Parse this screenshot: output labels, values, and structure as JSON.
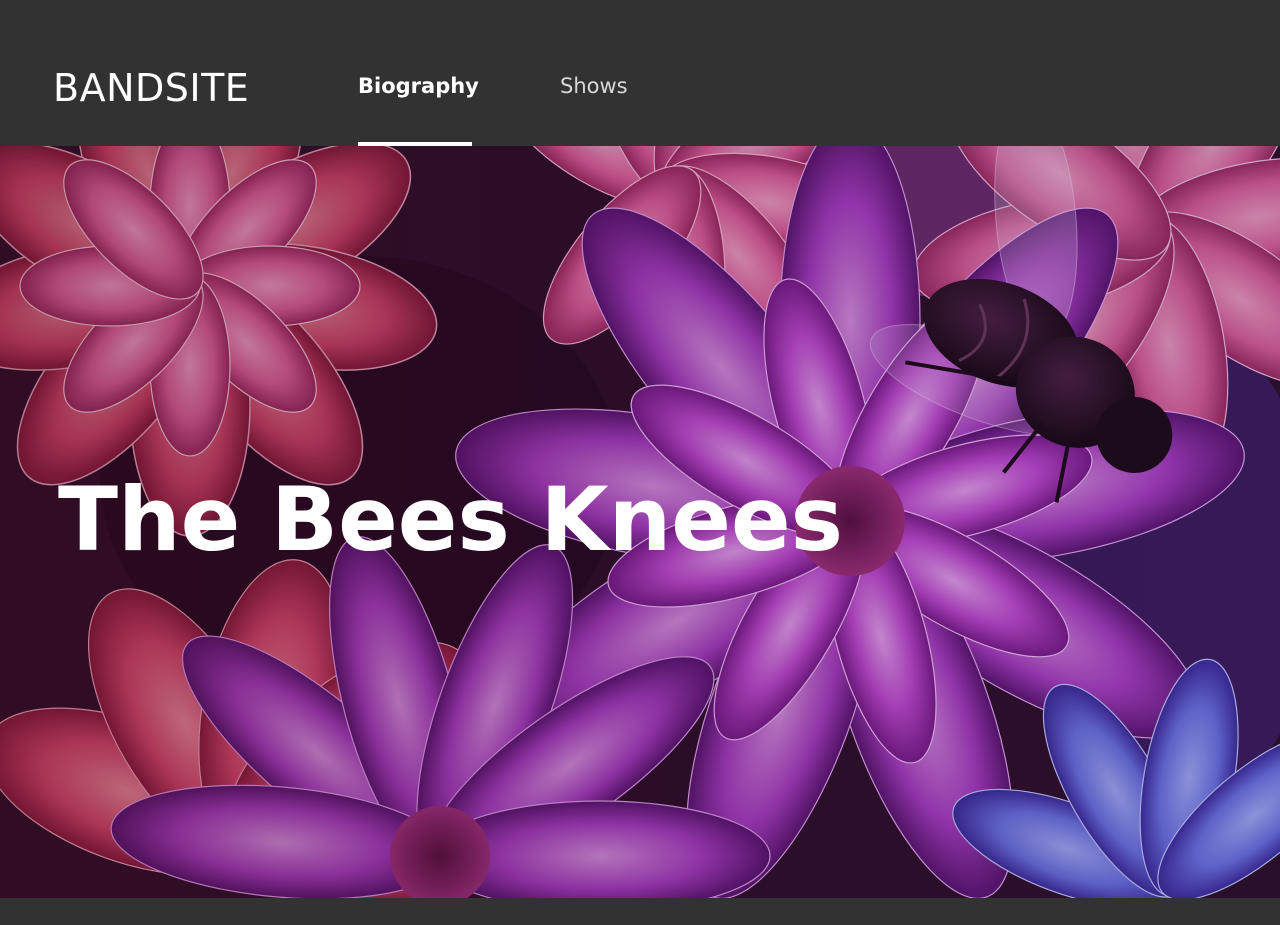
{
  "header": {
    "logo": "BANDSITE",
    "nav": [
      {
        "label": "Biography",
        "active": true
      },
      {
        "label": "Shows",
        "active": false
      }
    ]
  },
  "hero": {
    "title": "The Bees Knees",
    "image": "flowers-with-bee-photo"
  },
  "colors": {
    "header_bg": "#323232",
    "text_primary": "#ffffff",
    "nav_inactive": "#d8d8d8",
    "flower_pink": "#e0609a",
    "flower_magenta": "#c04ad0",
    "flower_blue": "#6a70e0"
  }
}
